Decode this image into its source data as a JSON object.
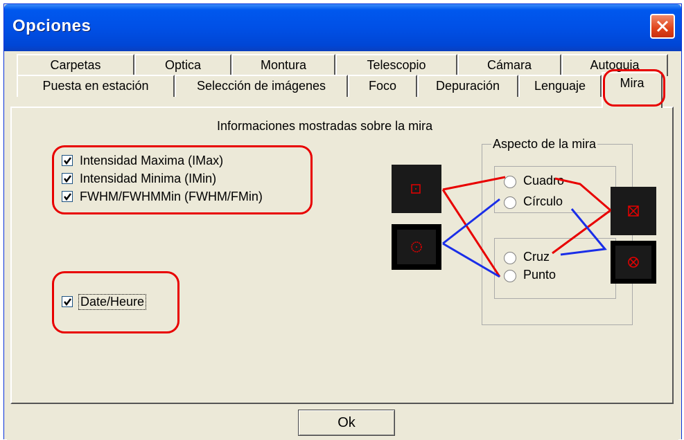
{
  "window": {
    "title": "Opciones"
  },
  "tabs_row1": [
    "Carpetas",
    "Optica",
    "Montura",
    "Telescopio",
    "Cámara",
    "Autoguia"
  ],
  "tabs_row2": [
    "Puesta en estación",
    "Selección de imágenes",
    "Foco",
    "Depuración",
    "Lenguaje",
    "Mira"
  ],
  "active_tab": "Mira",
  "panel": {
    "heading": "Informaciones mostradas sobre la mira",
    "checks": [
      {
        "label": "Intensidad Maxima (IMax)",
        "checked": true
      },
      {
        "label": "Intensidad Minima (IMin)",
        "checked": true
      },
      {
        "label": "FWHM/FWHMMin (FWHM/FMin)",
        "checked": true
      },
      {
        "label": "Date/Heure",
        "checked": true
      }
    ],
    "aspect": {
      "title": "Aspecto de la mira",
      "shape_options": [
        "Cuadro",
        "Círculo"
      ],
      "center_options": [
        "Cruz",
        "Punto"
      ]
    }
  },
  "ok_label": "Ok",
  "colors": {
    "title_bar": "#0058ee",
    "annotation_red": "#e80000",
    "annotation_blue": "#1a2ee8",
    "dialog_bg": "#ece9d8"
  }
}
